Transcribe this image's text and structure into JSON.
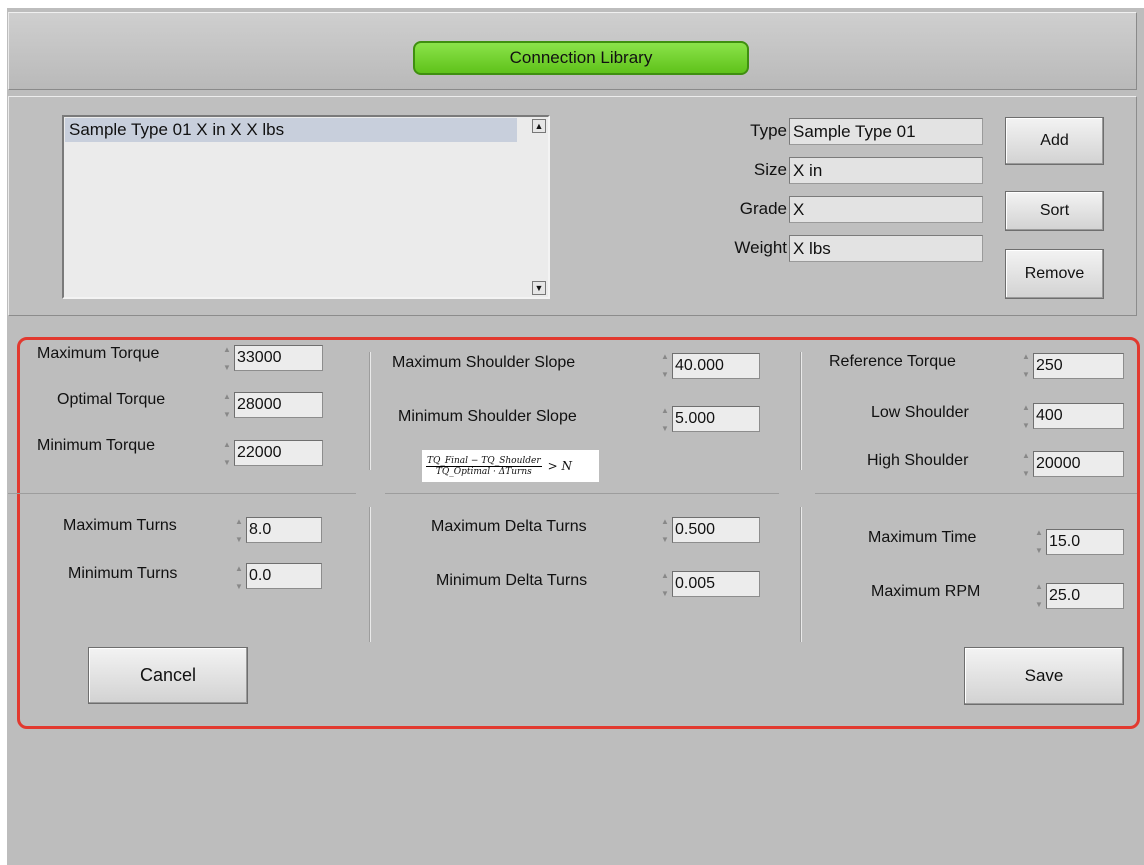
{
  "header": {
    "title": "Connection Library"
  },
  "library": {
    "items": [
      "Sample Type 01 X in X X lbs"
    ],
    "selected_index": 0,
    "fields": [
      {
        "label": "Type",
        "value": "Sample Type 01"
      },
      {
        "label": "Size",
        "value": "X in"
      },
      {
        "label": "Grade",
        "value": "X"
      },
      {
        "label": "Weight",
        "value": "X lbs"
      }
    ],
    "buttons": {
      "add": "Add",
      "sort": "Sort",
      "remove": "Remove"
    }
  },
  "torque": [
    {
      "label": "Maximum Torque",
      "value": "33000"
    },
    {
      "label": "Optimal Torque",
      "value": "28000"
    },
    {
      "label": "Minimum Torque",
      "value": "22000"
    }
  ],
  "shoulder_slope": [
    {
      "label": "Maximum Shoulder Slope",
      "value": "40.000"
    },
    {
      "label": "Minimum Shoulder Slope",
      "value": "5.000"
    }
  ],
  "formula": {
    "numerator": "TQ_Final − TQ_Shoulder",
    "denominator": "TQ_Optimal · ΔTurns",
    "comparison": "> N"
  },
  "shoulder": [
    {
      "label": "Reference Torque",
      "value": "250"
    },
    {
      "label": "Low Shoulder",
      "value": "400"
    },
    {
      "label": "High Shoulder",
      "value": "20000"
    }
  ],
  "turns": [
    {
      "label": "Maximum Turns",
      "value": "8.0"
    },
    {
      "label": "Minimum Turns",
      "value": "0.0"
    }
  ],
  "delta_turns": [
    {
      "label": "Maximum Delta Turns",
      "value": "0.500"
    },
    {
      "label": "Minimum Delta Turns",
      "value": "0.005"
    }
  ],
  "limits": [
    {
      "label": "Maximum Time",
      "value": "15.0"
    },
    {
      "label": "Maximum RPM",
      "value": "25.0"
    }
  ],
  "actions": {
    "cancel": "Cancel",
    "save": "Save"
  },
  "colors": {
    "title_green": "#6fd22a",
    "highlight_red": "#e2392f",
    "panel_gray": "#bdbdbd"
  }
}
